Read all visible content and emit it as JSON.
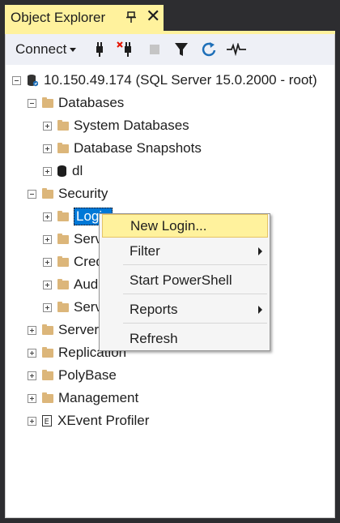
{
  "window": {
    "title": "Object Explorer"
  },
  "toolbar": {
    "connect_label": "Connect"
  },
  "tree": {
    "server": "10.150.49.174 (SQL Server 15.0.2000 - root)",
    "databases": "Databases",
    "system_databases": "System Databases",
    "database_snapshots": "Database Snapshots",
    "dl": "dl",
    "security": "Security",
    "logins": "Login",
    "server_roles": "Serv",
    "credentials": "Cred",
    "audits": "Aud",
    "server_audit_specs": "Serv",
    "server_objects": "Server",
    "replication": "Replication",
    "polybase": "PolyBase",
    "management": "Management",
    "xevent_profiler": "XEvent Profiler"
  },
  "context_menu": {
    "new_login": "New Login...",
    "filter": "Filter",
    "start_powershell": "Start PowerShell",
    "reports": "Reports",
    "refresh": "Refresh"
  },
  "colors": {
    "accent_tab": "#fff29d",
    "selection": "#0078d7",
    "dark_bg": "#2d2d30"
  }
}
